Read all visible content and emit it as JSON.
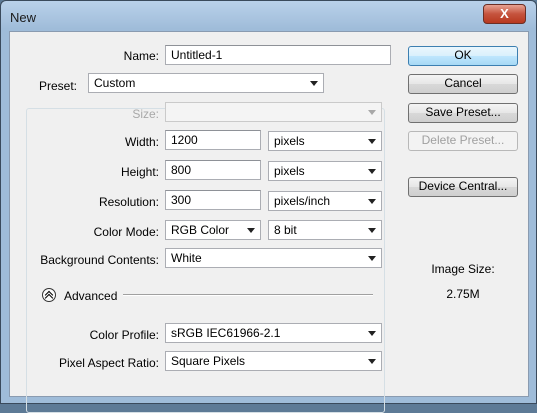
{
  "window": {
    "title": "New",
    "close_glyph": "X"
  },
  "form": {
    "name": {
      "label": "Name:",
      "value": "Untitled-1"
    },
    "preset": {
      "label": "Preset:",
      "value": "Custom"
    },
    "size": {
      "label": "Size:",
      "value": ""
    },
    "width": {
      "label": "Width:",
      "value": "1200",
      "unit": "pixels"
    },
    "height": {
      "label": "Height:",
      "value": "800",
      "unit": "pixels"
    },
    "resolution": {
      "label": "Resolution:",
      "value": "300",
      "unit": "pixels/inch"
    },
    "color_mode": {
      "label": "Color Mode:",
      "value": "RGB Color",
      "depth": "8 bit"
    },
    "background": {
      "label": "Background Contents:",
      "value": "White"
    },
    "advanced": {
      "label": "Advanced"
    },
    "color_profile": {
      "label": "Color Profile:",
      "value": "sRGB IEC61966-2.1"
    },
    "pixel_aspect": {
      "label": "Pixel Aspect Ratio:",
      "value": "Square Pixels"
    }
  },
  "buttons": {
    "ok": "OK",
    "cancel": "Cancel",
    "save_preset": "Save Preset...",
    "delete_preset": "Delete Preset...",
    "device_central": "Device Central..."
  },
  "image_size": {
    "label": "Image Size:",
    "value": "2.75M"
  },
  "colors": {
    "title_bar": "#9fbcd9",
    "client_bg": "#f0f0f0",
    "ok_accent": "#3c7fb1",
    "close_red": "#c5533d"
  },
  "icons": {
    "dropdown": "triangle-down",
    "advanced_toggle": "double-chevron-up"
  }
}
